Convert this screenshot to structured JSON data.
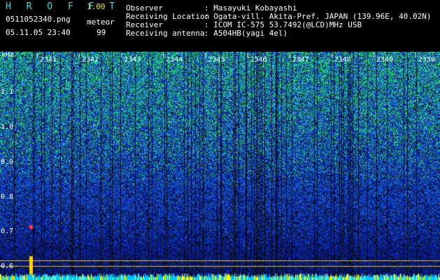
{
  "app": {
    "name": "H R O F F T",
    "version": "1.00"
  },
  "file": {
    "name": "0511052340.png",
    "datetime": "05.11.05 23:40"
  },
  "detector": {
    "label": "meteor",
    "count": "99"
  },
  "info": [
    {
      "key": "Observer",
      "value": ": Masayuki Kobayashi"
    },
    {
      "key": "Receiving Location",
      "value": ": Ogata-vill. Akita-Pref. JAPAN (139.96E, 40.02N)"
    },
    {
      "key": "Receiver",
      "value": ": ICOM IC-575 53.7492(@LCD)MHz USB"
    },
    {
      "key": "Receiving antenna",
      "value": ": A504HB(yagi 4el)"
    }
  ],
  "axis": {
    "y_unit": "kHz",
    "y_ticks": [
      "1.1",
      "1.0",
      "0.9",
      "0.8",
      "0.7",
      "0.6"
    ],
    "x_ticks": [
      "2341",
      "2342",
      "2343",
      "2344",
      "2345",
      "2346",
      "2347",
      "2348",
      "2349",
      "2350"
    ]
  },
  "colors": {
    "background": "#000000",
    "accent": "#29e7e7",
    "marker": "#e8e800"
  }
}
